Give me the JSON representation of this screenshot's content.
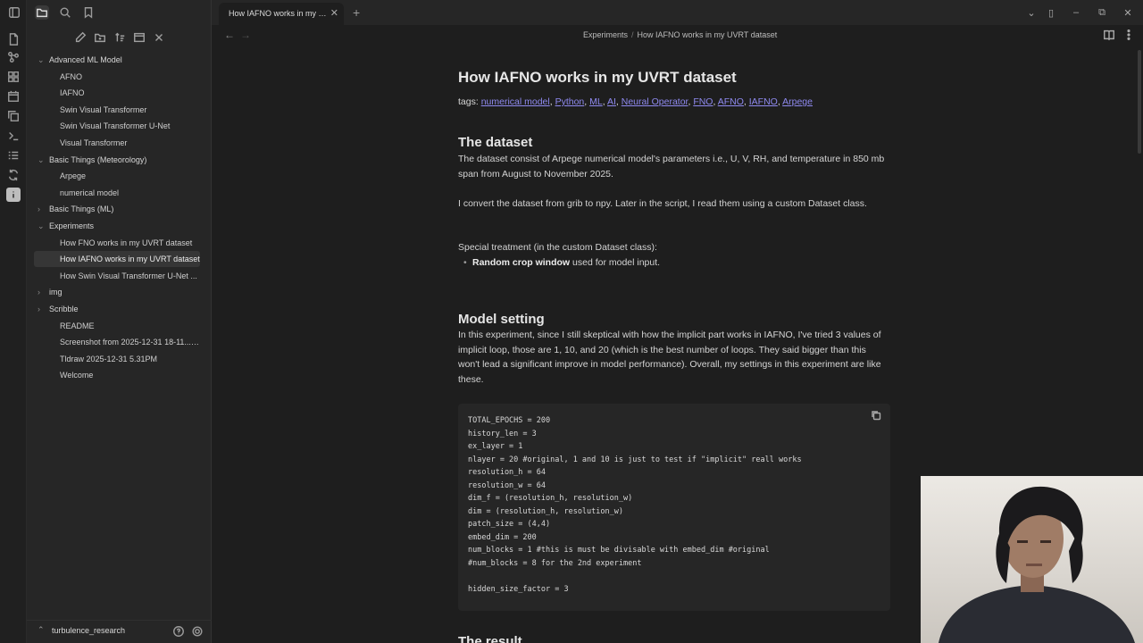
{
  "ribbon": {
    "icons": [
      "file-icon",
      "graph-icon",
      "grid-icon",
      "calendar-icon",
      "copy-icon",
      "terminal-icon",
      "list-icon",
      "sync-icon",
      "info-icon"
    ]
  },
  "sidebar": {
    "top_icons": [
      "sidebar-toggle-icon",
      "folder-icon",
      "search-icon",
      "bookmark-icon"
    ],
    "actions": [
      "new-note-icon",
      "new-folder-icon",
      "sort-icon",
      "collapse-icon",
      "close-all-icon"
    ],
    "tree": [
      {
        "label": "Advanced ML Model",
        "folder": true,
        "expanded": true
      },
      {
        "label": "AFNO"
      },
      {
        "label": "IAFNO"
      },
      {
        "label": "Swin Visual Transformer"
      },
      {
        "label": "Swin Visual Transformer U-Net"
      },
      {
        "label": "Visual Transformer"
      },
      {
        "label": "Basic Things (Meteorology)",
        "folder": true,
        "expanded": true
      },
      {
        "label": "Arpege"
      },
      {
        "label": "numerical model"
      },
      {
        "label": "Basic Things (ML)",
        "folder": true,
        "expanded": false
      },
      {
        "label": "Experiments",
        "folder": true,
        "expanded": true
      },
      {
        "label": "How FNO works in my UVRT dataset"
      },
      {
        "label": "How IAFNO works in my UVRT dataset",
        "active": true
      },
      {
        "label": "How Swin Visual Transformer U-Net ..."
      },
      {
        "label": "img",
        "folder": true,
        "expanded": false
      },
      {
        "label": "Scribble",
        "folder": true,
        "expanded": false
      },
      {
        "label": "README"
      },
      {
        "label": "Screenshot from 2025-12-31 18-11...",
        "tag": "PNG"
      },
      {
        "label": "Tldraw 2025-12-31 5.31PM"
      },
      {
        "label": "Welcome"
      }
    ],
    "vault_name": "turbulence_research"
  },
  "tabs": [
    {
      "label": "How IAFNO works in my UVRT dataset",
      "active": true
    }
  ],
  "breadcrumb": {
    "folder": "Experiments",
    "sep": "/",
    "file": "How IAFNO works in my UVRT dataset"
  },
  "doc": {
    "title": "How IAFNO works in my UVRT dataset",
    "tags_label": "tags:",
    "tags": [
      "numerical model",
      "Python",
      "ML",
      "AI",
      "Neural Operator",
      "FNO",
      "AFNO",
      "IAFNO",
      "Arpege"
    ],
    "h_dataset": "The dataset",
    "p1": "The dataset consist of Arpege numerical model's parameters i.e., U, V, RH, and temperature in 850 mb span from August to November 2025.",
    "p2": "I convert the dataset from grib to npy. Later in the script, I read them using a custom Dataset class.",
    "p3": "Special treatment (in the custom Dataset class):",
    "bullet_bold": "Random crop window",
    "bullet_rest": " used for model input.",
    "h_model": "Model setting",
    "p4": "In this experiment, since I still skeptical with how the implicit part works in IAFNO, I've tried 3 values of implicit loop, those are 1, 10, and 20 (which is the best number of loops. They said bigger than this won't lead a significant improve in model performance). Overall, my settings in this experiment are like these.",
    "code": "TOTAL_EPOCHS = 200\nhistory_len = 3\nex_layer = 1\nnlayer = 20 #original, 1 and 10 is just to test if \"implicit\" reall works\nresolution_h = 64\nresolution_w = 64\ndim_f = (resolution_h, resolution_w)\ndim = (resolution_h, resolution_w)\npatch_size = (4,4)\nembed_dim = 200\nnum_blocks = 1 #this is must be divisable with embed_dim #original\n#num_blocks = 8 for the 2nd experiment\n\nhidden_size_factor = 3",
    "h_result": "The result"
  }
}
